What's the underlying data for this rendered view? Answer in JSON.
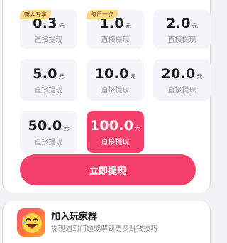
{
  "options": [
    {
      "amount": "0.3",
      "unit": "元",
      "sub": "直接提现",
      "tag": "新人专享",
      "selected": false
    },
    {
      "amount": "1.0",
      "unit": "元",
      "sub": "直接提现",
      "tag": "每日一次",
      "selected": false
    },
    {
      "amount": "2.0",
      "unit": "元",
      "sub": "直接提现",
      "tag": "",
      "selected": false
    },
    {
      "amount": "5.0",
      "unit": "元",
      "sub": "直接提现",
      "tag": "",
      "selected": false
    },
    {
      "amount": "10.0",
      "unit": "元",
      "sub": "直接提现",
      "tag": "",
      "selected": false
    },
    {
      "amount": "20.0",
      "unit": "元",
      "sub": "直接提现",
      "tag": "",
      "selected": false
    },
    {
      "amount": "50.0",
      "unit": "元",
      "sub": "直接提现",
      "tag": "",
      "selected": false
    },
    {
      "amount": "100.0",
      "unit": "元",
      "sub": "直接提现",
      "tag": "",
      "selected": true
    }
  ],
  "withdraw_button": {
    "label": "立即提现"
  },
  "group": {
    "title": "加入玩家群",
    "description": "提现遇到问题或解锁更多赚钱技巧",
    "icon": "laughing-face-icon"
  },
  "colors": {
    "accent": "#f43f6b",
    "tag_bg": "#fcd98a",
    "option_bg": "#f4f5f8"
  }
}
